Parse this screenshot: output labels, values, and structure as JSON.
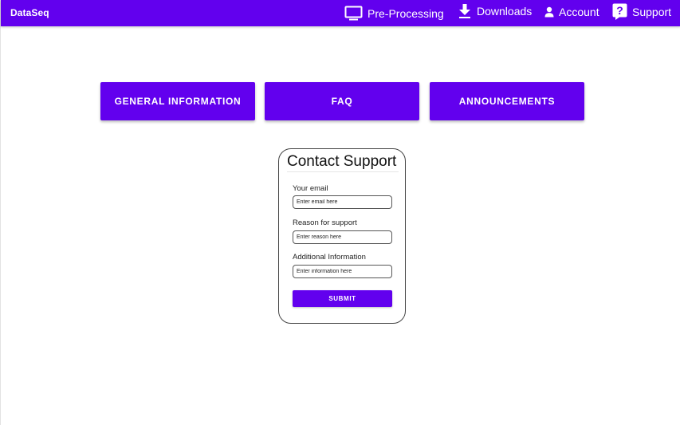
{
  "appbar": {
    "brand": "DataSeq",
    "nav": [
      {
        "label": "Pre-Processing",
        "icon": "monitor-icon"
      },
      {
        "label": "Downloads",
        "icon": "download-icon"
      },
      {
        "label": "Account",
        "icon": "person-icon"
      },
      {
        "label": "Support",
        "icon": "help-icon"
      }
    ]
  },
  "main_buttons": [
    {
      "label": "GENERAL INFORMATION"
    },
    {
      "label": "FAQ"
    },
    {
      "label": "ANNOUNCEMENTS"
    }
  ],
  "contact_form": {
    "title": "Contact Support",
    "email": {
      "label": "Your email",
      "placeholder": "Enter email here",
      "value": ""
    },
    "reason": {
      "label": "Reason for support",
      "placeholder": "Enter reason here",
      "value": ""
    },
    "info": {
      "label": "Additional Information",
      "placeholder": "Enter information here",
      "value": ""
    },
    "submit_label": "SUBMIT"
  },
  "colors": {
    "primary": "#6200ee",
    "on_primary": "#ffffff",
    "background": "#ffffff"
  }
}
